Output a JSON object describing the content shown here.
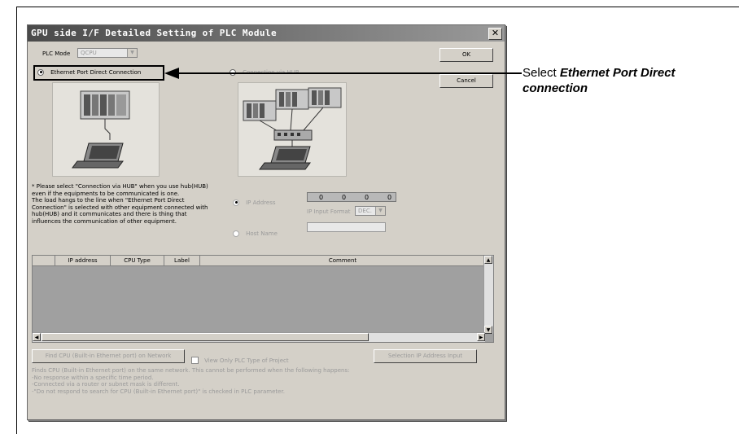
{
  "dialog": {
    "title": "GPU side I/F Detailed Setting of PLC Module",
    "close_glyph": "✕",
    "ok_label": "OK",
    "cancel_label": "Cancel"
  },
  "plc_mode": {
    "label": "PLC Mode",
    "value": "QCPU"
  },
  "connection": {
    "direct_label": "Ethernet Port Direct Connection",
    "hub_label": "Connection via HUB",
    "selected": "direct"
  },
  "note": {
    "line1": "* Please select \"Connection via HUB\" when you use hub(HUB)",
    "line2": "even if the equipments to be communicated is one.",
    "line3": "The load hangs to the line when \"Ethernet Port Direct",
    "line4": "Connection\" is selected with other equipment connected with",
    "line5": "hub(HUB) and it communicates and there is thing that",
    "line6": "influences the communication of other equipment."
  },
  "ip": {
    "ip_address_label": "IP Address",
    "octets": [
      "0",
      "0",
      "0",
      "0"
    ],
    "input_format_label": "IP Input Format",
    "input_format_value": "DEC.",
    "host_name_label": "Host Name"
  },
  "table": {
    "columns": [
      "",
      "IP address",
      "CPU Type",
      "Label",
      "Comment"
    ]
  },
  "bottom": {
    "find_button": "Find CPU (Built-in Ethernet port) on Network",
    "view_only_label": "View Only PLC Type of Project",
    "selection_button": "Selection IP Address Input",
    "info1": "Finds CPU (Built-in Ethernet port) on the same network. This cannot be performed when the following happens:",
    "info2": "-No response within a specific time period.",
    "info3": "-Connected via a router or subnet mask is different.",
    "info4": "-\"Do not respond to search for CPU (Built-in Ethernet port)\" is checked in PLC parameter."
  },
  "annotation": {
    "prefix": "Select ",
    "bold": "Ethernet Port Direct connection"
  },
  "colors": {
    "titlebar_start": "#4a4a4a",
    "titlebar_end": "#9a9a9a",
    "dialog_bg": "#d4d0c8",
    "grid_bg": "#a0a0a0"
  }
}
